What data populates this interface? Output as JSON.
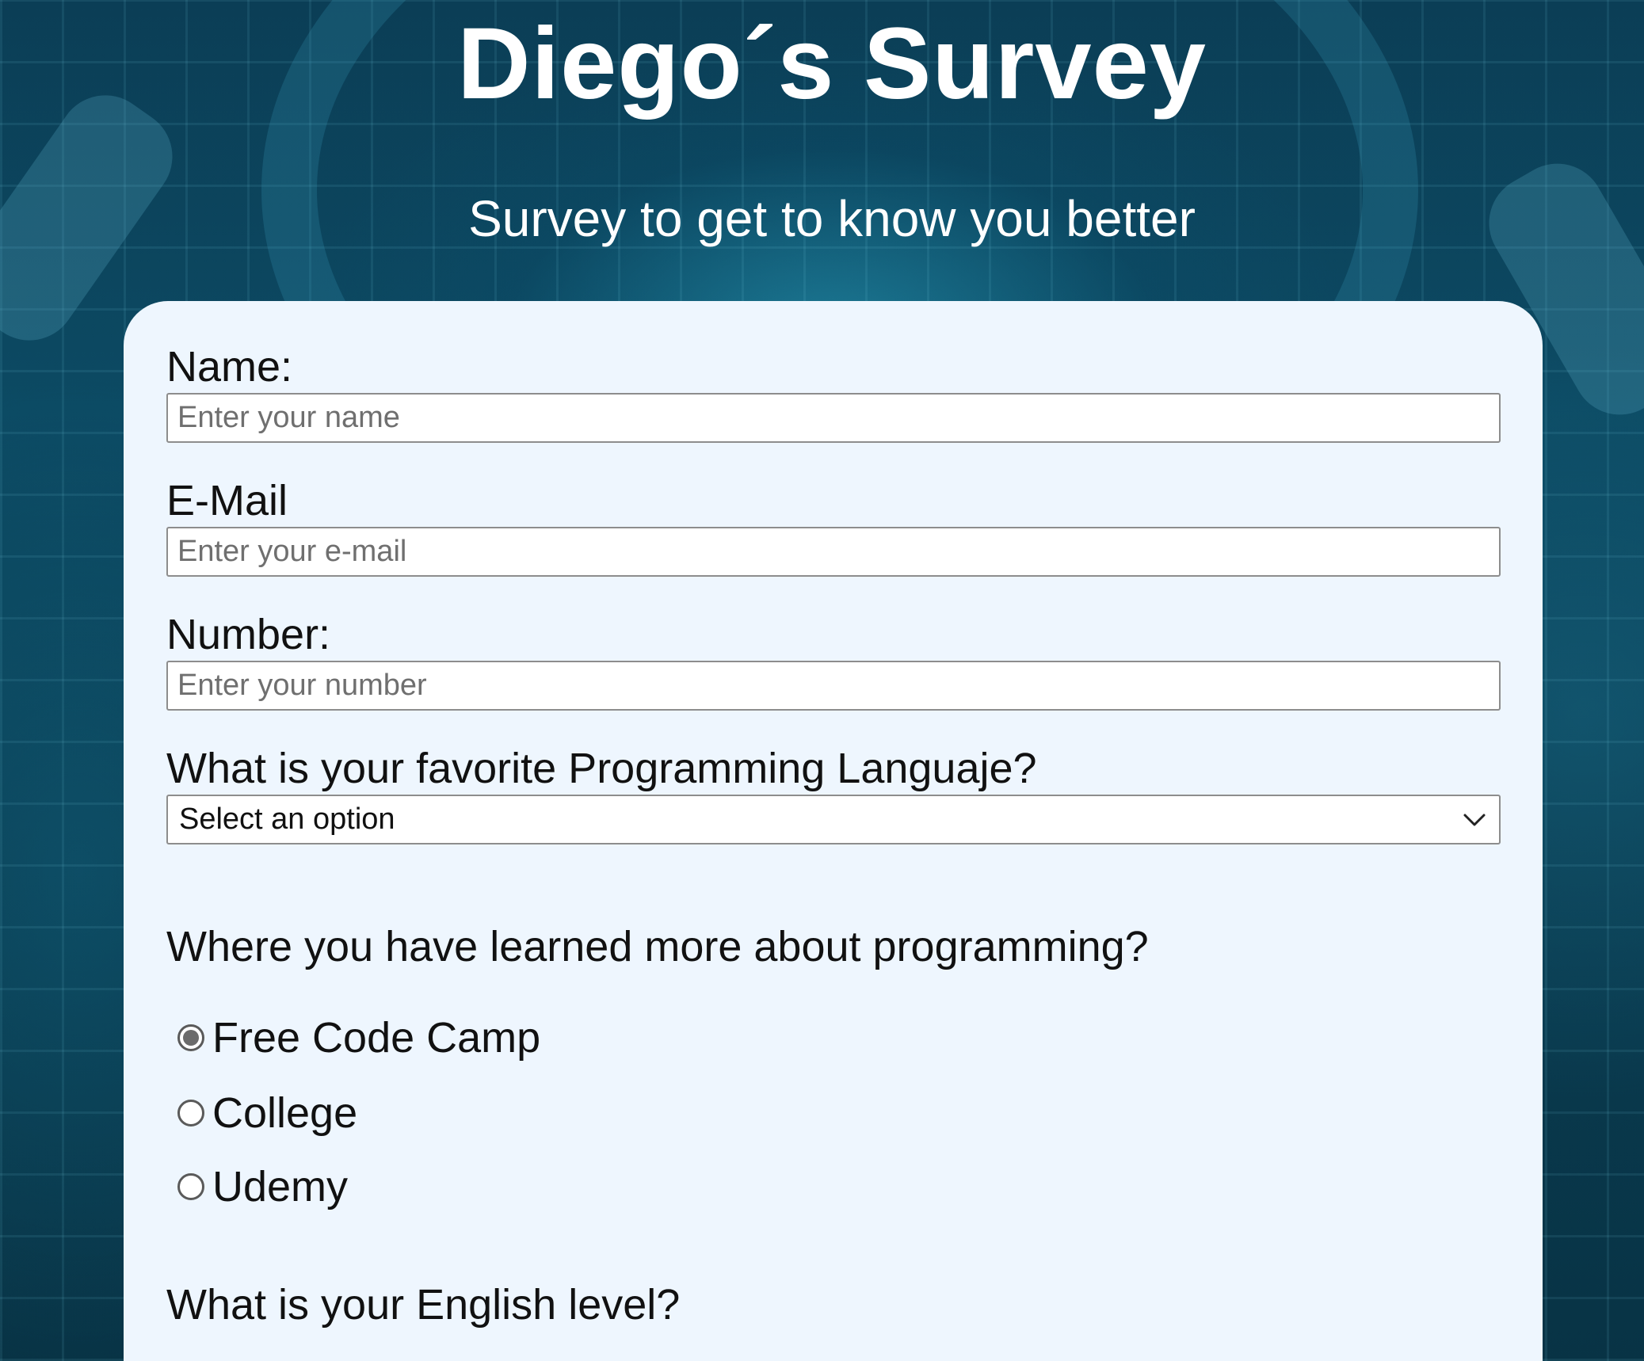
{
  "header": {
    "title": "Diego´s Survey",
    "subtitle": "Survey to get to know you better"
  },
  "form": {
    "name": {
      "label": "Name:",
      "placeholder": "Enter your name"
    },
    "email": {
      "label": "E-Mail",
      "placeholder": "Enter your e-mail"
    },
    "number": {
      "label": "Number:",
      "placeholder": "Enter your number"
    },
    "language": {
      "label": "What is your favorite Programming Languaje?",
      "selected": "Select an option",
      "icon": "chevron-down-icon"
    },
    "learned": {
      "question": "Where you have learned more about programming?",
      "options": [
        {
          "label": "Free Code Camp",
          "checked": true
        },
        {
          "label": "College",
          "checked": false
        },
        {
          "label": "Udemy",
          "checked": false
        }
      ]
    },
    "english": {
      "question": "What is your English level?"
    }
  },
  "colors": {
    "card_background": "#eef6fe",
    "page_background": "#0c4a63",
    "header_text": "#ffffff"
  }
}
